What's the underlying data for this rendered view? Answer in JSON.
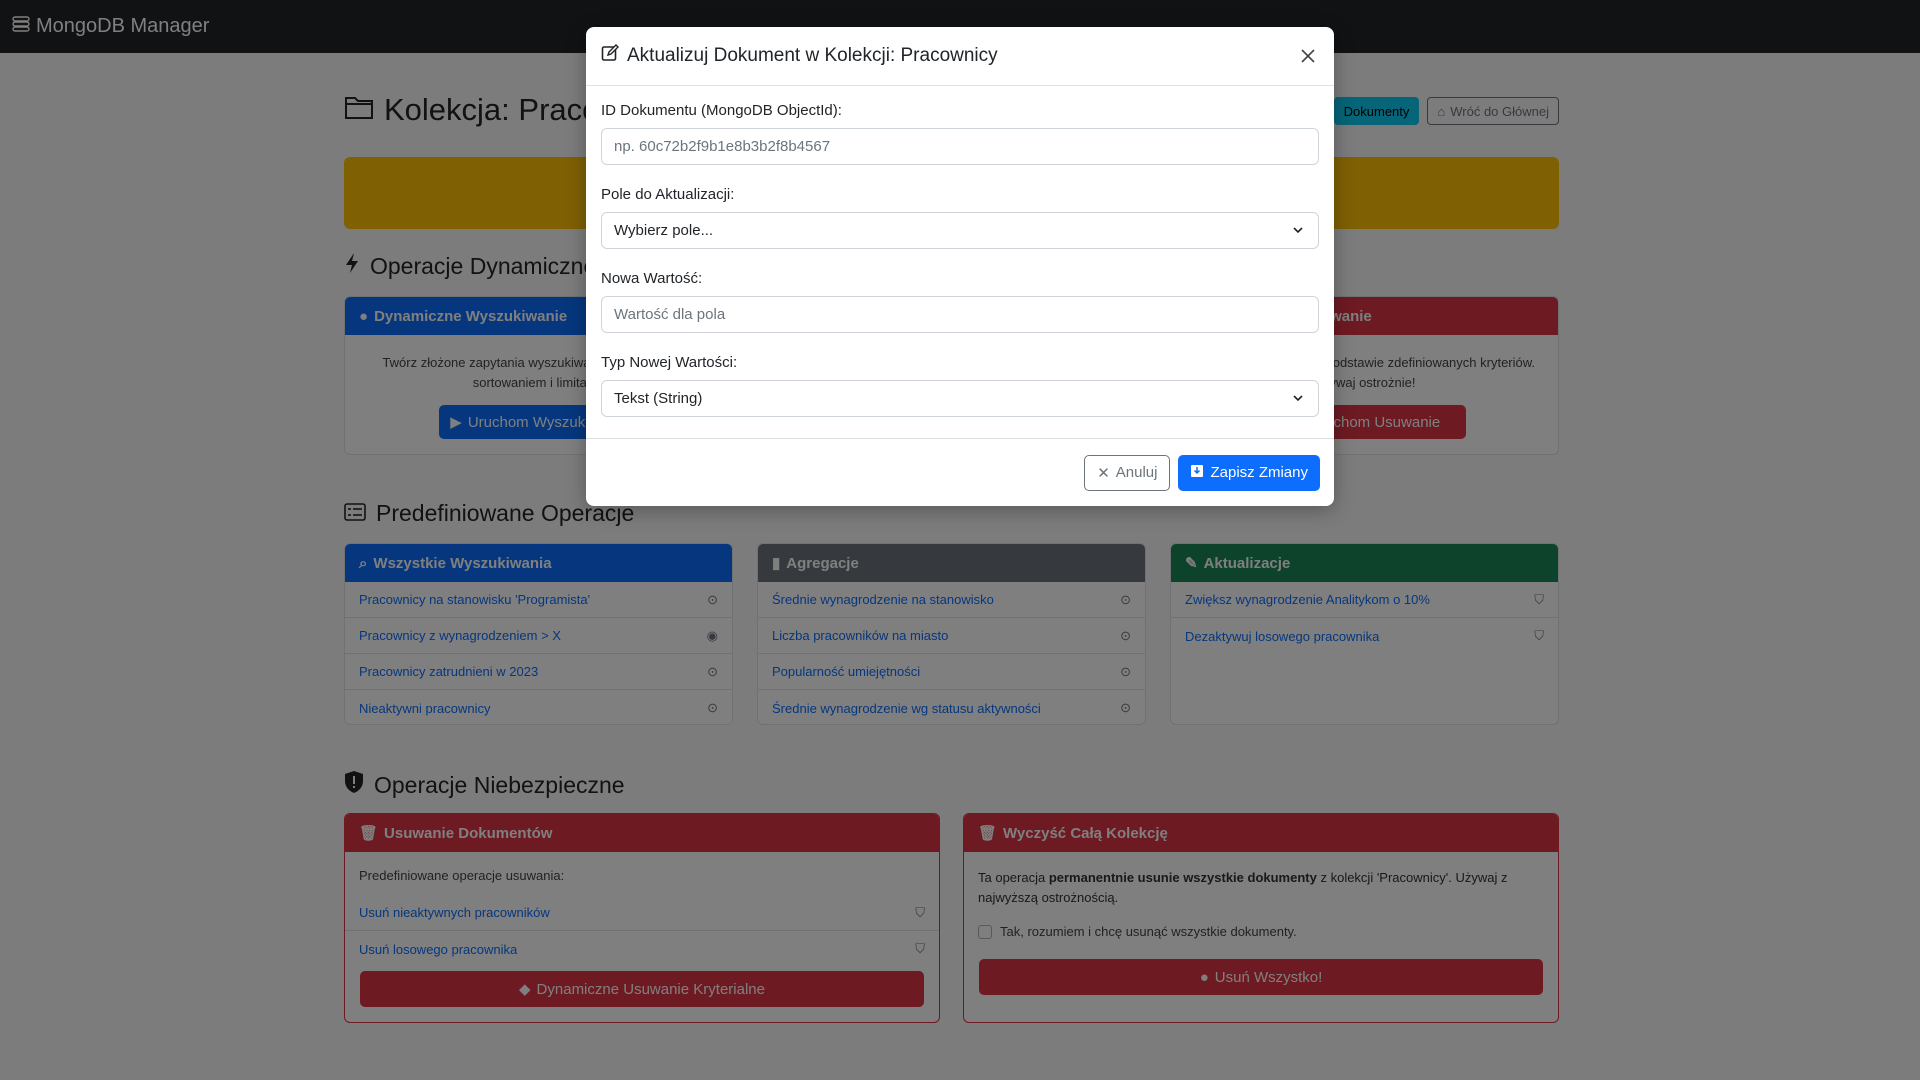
{
  "navbar": {
    "brand": "MongoDB Manager"
  },
  "page": {
    "title": "Kolekcja: Pracownicy",
    "actions": {
      "documents": "Dokumenty",
      "back": "Wróć do Głównej"
    }
  },
  "dynamic": {
    "title": "Operacje Dynamiczne",
    "search": {
      "header": "Dynamiczne Wyszukiwanie",
      "text": "Twórz złożone zapytania wyszukiwania z filtrowaniem, sortowaniem i limitami.",
      "button": "Uruchom Wyszukiwanie"
    },
    "delete": {
      "header": "Dynamiczne Usuwanie",
      "text": "Usuwaj dokumenty na podstawie zdefiniowanych kryteriów. Używaj ostrożnie!",
      "button": "Uruchom Usuwanie"
    }
  },
  "predefined": {
    "title": "Predefiniowane Operacje",
    "searches": {
      "header": "Wszystkie Wyszukiwania",
      "items": [
        "Pracownicy na stanowisku 'Programista'",
        "Pracownicy z wynagrodzeniem > X",
        "Pracownicy zatrudnieni w 2023",
        "Nieaktywni pracownicy"
      ]
    },
    "aggregations": {
      "header": "Agregacje",
      "items": [
        "Średnie wynagrodzenie na stanowisko",
        "Liczba pracowników na miasto",
        "Popularność umiejętności",
        "Średnie wynagrodzenie wg statusu aktywności"
      ]
    },
    "updates": {
      "header": "Aktualizacje",
      "items": [
        "Zwiększ wynagrodzenie Analitykom o 10%",
        "Dezaktywuj losowego pracownika"
      ]
    }
  },
  "danger": {
    "title": "Operacje Niebezpieczne",
    "deleteDocs": {
      "header": "Usuwanie Dokumentów",
      "intro": "Predefiniowane operacje usuwania:",
      "items": [
        "Usuń nieaktywnych pracowników",
        "Usuń losowego pracownika"
      ],
      "button": "Dynamiczne Usuwanie Kryterialne"
    },
    "clearAll": {
      "header": "Wyczyść Całą Kolekcję",
      "text_before": "Ta operacja ",
      "text_bold": "permanentnie usunie wszystkie dokumenty",
      "text_after": " z kolekcji 'Pracownicy'. Używaj z najwyższą ostrożnością.",
      "checkbox": "Tak, rozumiem i chcę usunąć wszystkie dokumenty.",
      "button": "Usuń Wszystko!"
    }
  },
  "modal": {
    "title": "Aktualizuj Dokument w Kolekcji: Pracownicy",
    "id_label": "ID Dokumentu (MongoDB ObjectId):",
    "id_placeholder": "np. 60c72b2f9b1e8b3b2f8b4567",
    "field_label": "Pole do Aktualizacji:",
    "field_value": "Wybierz pole...",
    "value_label": "Nowa Wartość:",
    "value_placeholder": "Wartość dla pola",
    "type_label": "Typ Nowej Wartości:",
    "type_value": "Tekst (String)",
    "cancel": "Anuluj",
    "save": "Zapisz Zmiany"
  }
}
